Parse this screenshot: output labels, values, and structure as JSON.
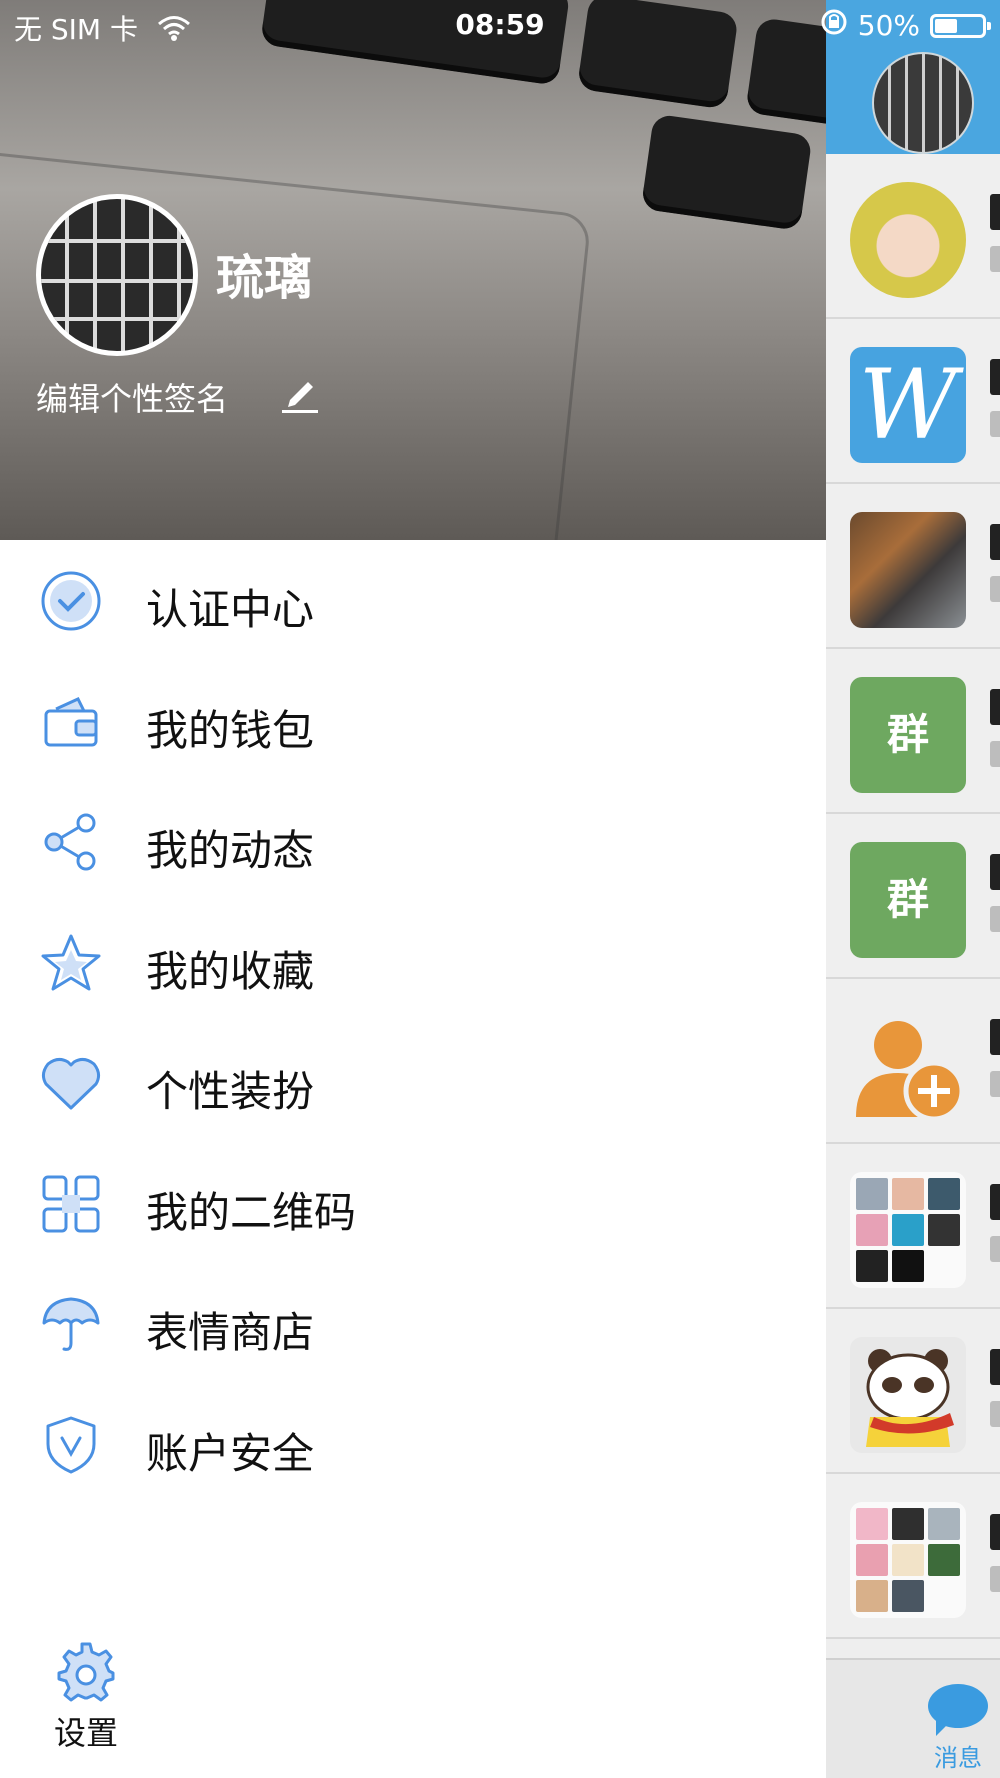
{
  "status_bar": {
    "carrier": "无 SIM 卡",
    "time": "08:59",
    "battery": "50%"
  },
  "profile": {
    "name": "琉璃",
    "signature": "编辑个性签名"
  },
  "menu": [
    {
      "label": "认证中心",
      "icon": "verified-check-icon"
    },
    {
      "label": "我的钱包",
      "icon": "wallet-icon"
    },
    {
      "label": "我的动态",
      "icon": "share-icon"
    },
    {
      "label": "我的收藏",
      "icon": "star-icon"
    },
    {
      "label": "个性装扮",
      "icon": "heart-tag-icon"
    },
    {
      "label": "我的二维码",
      "icon": "qr-code-icon"
    },
    {
      "label": "表情商店",
      "icon": "umbrella-icon"
    },
    {
      "label": "账户安全",
      "icon": "shield-icon"
    }
  ],
  "settings": {
    "label": "设置",
    "icon": "gear-icon"
  },
  "chat_preview": {
    "group_badge": "群",
    "tab_label": "消息"
  },
  "colors": {
    "accent": "#4a90e2",
    "icon_fill": "#cfe0f7",
    "header_blue": "#4aa6e0",
    "group_green": "#6ea860"
  }
}
